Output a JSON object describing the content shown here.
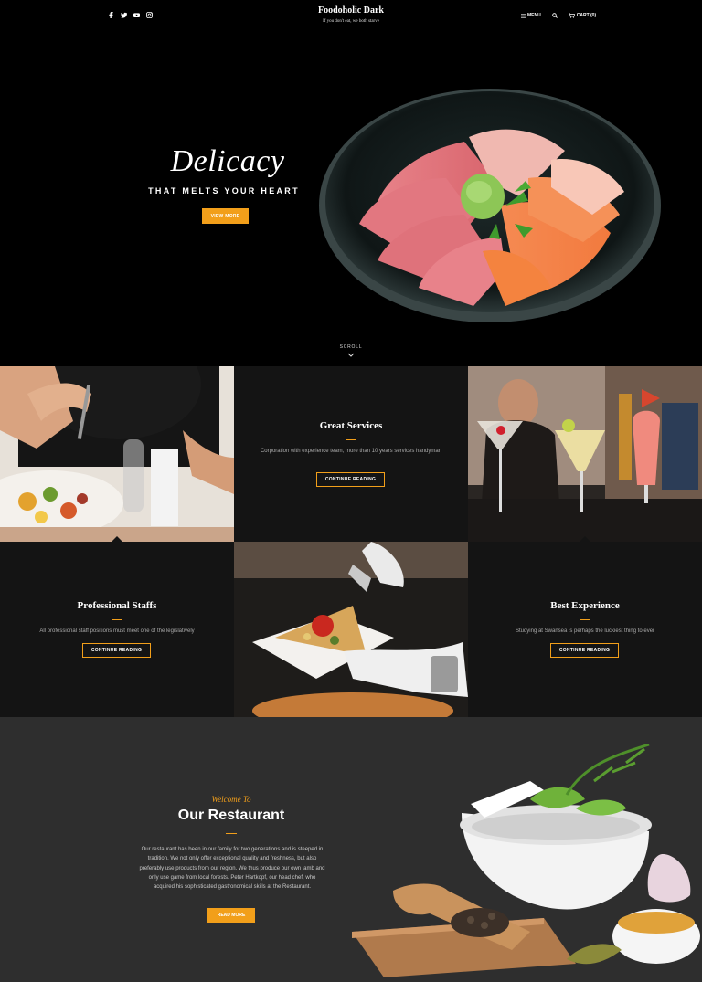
{
  "header": {
    "social_icons": [
      "facebook-icon",
      "twitter-icon",
      "youtube-icon",
      "instagram-icon"
    ],
    "site_title": "Foodoholic Dark",
    "tagline": "If you don't eat, we both starve",
    "menu_label": "MENU",
    "cart_label": "CART (0)"
  },
  "hero": {
    "script_title": "Delicacy",
    "subtitle": "THAT MELTS YOUR HEART",
    "button_label": "VIEW MORE",
    "scroll_label": "SCROLL"
  },
  "features": [
    {
      "title": "Great Services",
      "text": "Corporation with experience team, more than 10 years services handyman",
      "button_label": "CONTINUE READING"
    },
    {
      "title": "Professional Staffs",
      "text": "All professional staff positions must meet one of the legislatively",
      "button_label": "CONTINUE READING"
    },
    {
      "title": "Best Experience",
      "text": "Studying at Swansea is perhaps the luckiest thing to ever",
      "button_label": "CONTINUE READING"
    }
  ],
  "restaurant": {
    "welcome": "Welcome To",
    "title": "Our Restaurant",
    "text": "Our restaurant has been in our family for two generations and is steeped in tradition. We not only offer exceptional quality and freshness, but also preferably use products from our region. We thus produce our own lamb and only use game from local forests. Peter Hartkopf, our head chef, who acquired his sophisticated gastronomical skills at the Restaurant.",
    "button_label": "READ MORE"
  },
  "colors": {
    "accent": "#f29f1a",
    "dark_cell": "#141414",
    "section_bg": "#2e2e2e"
  }
}
